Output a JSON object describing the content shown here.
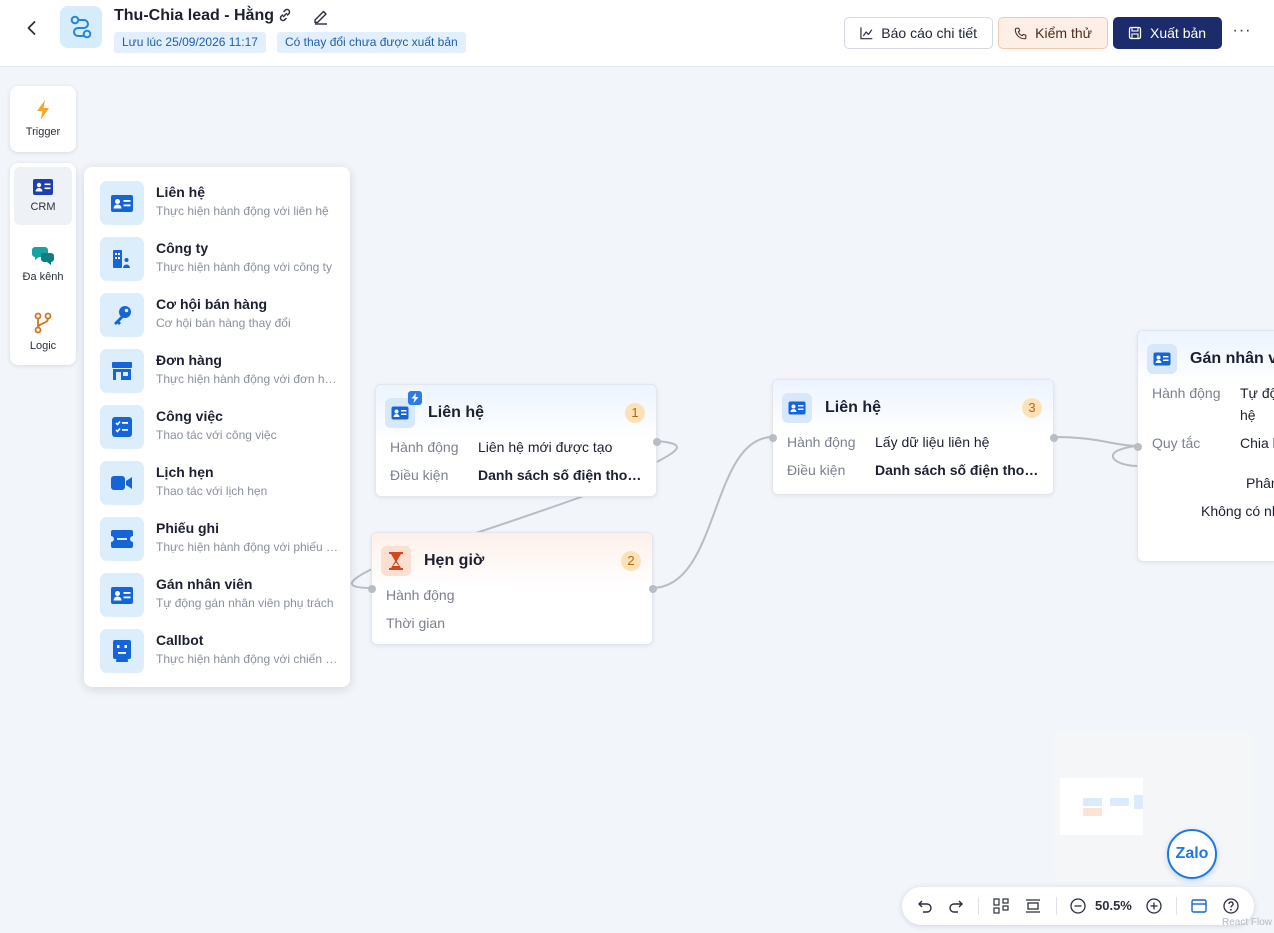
{
  "header": {
    "title": "Thu-Chia lead - Hằng",
    "saved_tag": "Lưu lúc 25/09/2026 11:17",
    "changes_tag": "Có thay đổi chưa được xuất bản",
    "report_label": "Báo cáo chi tiết",
    "test_label": "Kiểm thử",
    "publish_label": "Xuất bản",
    "more_label": "···"
  },
  "rail": {
    "trigger": "Trigger",
    "crm": "CRM",
    "omni": "Đa kênh",
    "logic": "Logic"
  },
  "crm_menu": [
    {
      "label": "Liên hệ",
      "desc": "Thực hiện hành động với liên hệ",
      "icon": "contact-card-icon"
    },
    {
      "label": "Công ty",
      "desc": "Thực hiện hành động với công ty",
      "icon": "company-icon"
    },
    {
      "label": "Cơ hội bán hàng",
      "desc": "Cơ hội bán hàng thay đổi",
      "icon": "key-icon"
    },
    {
      "label": "Đơn hàng",
      "desc": "Thực hiện hành động với đơn hàng",
      "icon": "store-icon"
    },
    {
      "label": "Công việc",
      "desc": "Thao tác với công việc",
      "icon": "checklist-icon"
    },
    {
      "label": "Lịch hẹn",
      "desc": "Thao tác với lịch hẹn",
      "icon": "video-camera-icon"
    },
    {
      "label": "Phiếu ghi",
      "desc": "Thực hiện hành động với phiếu ghi",
      "icon": "ticket-icon"
    },
    {
      "label": "Gán nhân viên",
      "desc": "Tự động gán nhân viên phụ trách",
      "icon": "contact-card-icon"
    },
    {
      "label": "Callbot",
      "desc": "Thực hiện hành động với chiến dịch",
      "icon": "callbot-icon"
    }
  ],
  "nodes": {
    "n1": {
      "title": "Liên hệ",
      "badge": "1",
      "k1": "Hành động",
      "v1": "Liên hệ mới được tạo",
      "k2": "Điều kiện",
      "v2": "Danh sách số điện thoại ..."
    },
    "n2": {
      "title": "Hẹn giờ",
      "badge": "2",
      "k1": "Hành động",
      "k2": "Thời gian"
    },
    "n3": {
      "title": "Liên hệ",
      "badge": "3",
      "k1": "Hành động",
      "v1": "Lấy dữ liệu liên hệ",
      "k2": "Điều kiện",
      "v2": "Danh sách số điện thoại ..."
    },
    "n4": {
      "title": "Gán nhân vi",
      "k1": "Hành động",
      "v1a": "Tự độ",
      "v1b": "hệ",
      "k2": "Quy tắc",
      "v2": "Chia l",
      "extra1": "Phân",
      "extra2": "Không có nh"
    }
  },
  "toolbar": {
    "zoom": "50.5%"
  },
  "widget": {
    "zalo": "Zalo"
  },
  "watermark": "React Flow",
  "colors": {
    "primary": "#1b2b6b",
    "accent_blue": "#2d7be5",
    "badge": "#fde2b8",
    "test_button": "#fdefe5"
  }
}
